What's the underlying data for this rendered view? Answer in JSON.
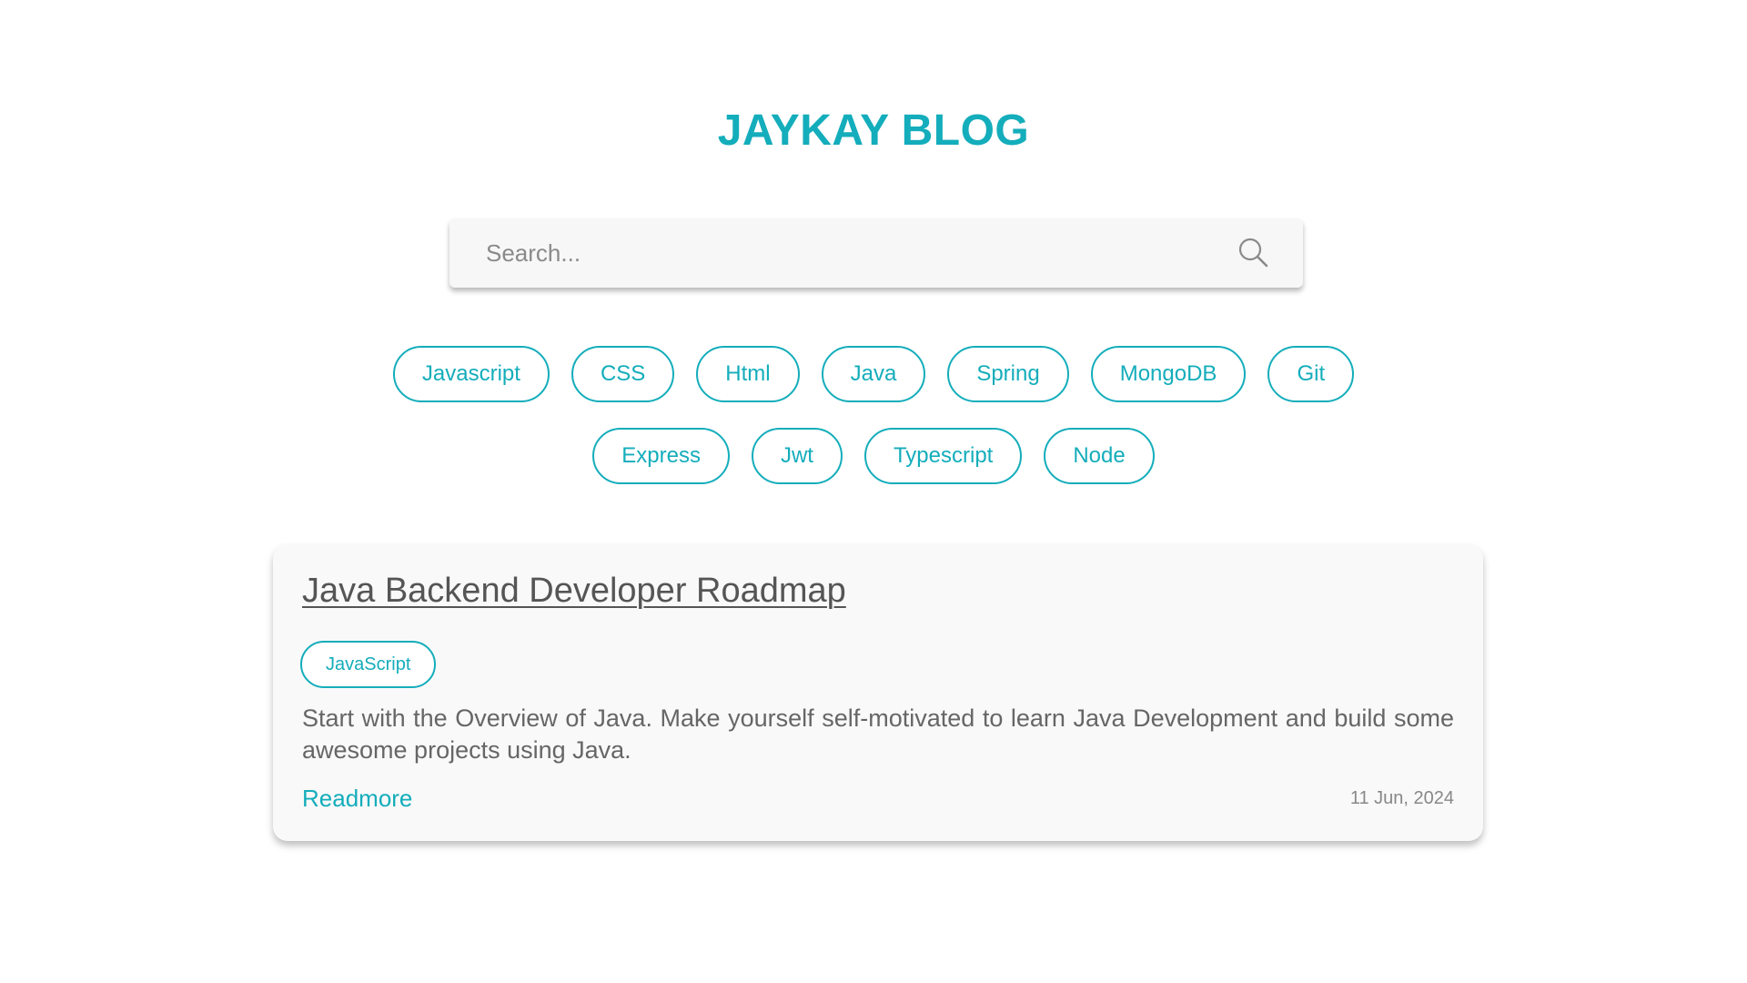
{
  "header": {
    "title": "JAYKAY BLOG"
  },
  "search": {
    "placeholder": "Search...",
    "value": "",
    "icon": "search-icon"
  },
  "tags": {
    "row1": [
      "Javascript",
      "CSS",
      "Html",
      "Java",
      "Spring",
      "MongoDB",
      "Git"
    ],
    "row2": [
      "Express",
      "Jwt",
      "Typescript",
      "Node"
    ]
  },
  "posts": [
    {
      "title": "Java Backend Developer Roadmap",
      "tag": "JavaScript",
      "excerpt": "Start with the Overview of Java. Make yourself self-motivated to learn Java Development and build some awesome projects using Java.",
      "readmore_label": "Readmore",
      "date": "11 Jun, 2024"
    }
  ],
  "colors": {
    "accent": "#14adbb",
    "card_background": "#f9f9f9",
    "text": "#555555"
  }
}
